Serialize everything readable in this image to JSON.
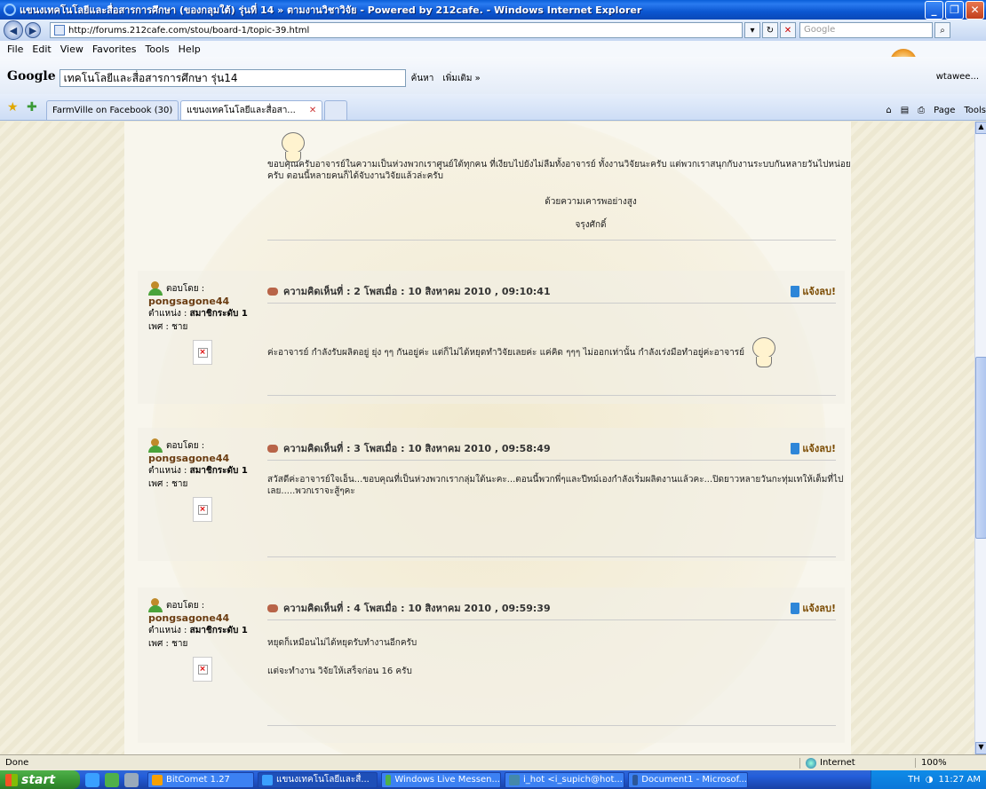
{
  "window": {
    "title": "แขนงเทคโนโลยีและสื่อสารการศึกษา (ของกลุมใต้) รุ่นที่ 14 » ตามงานวิชาวิจัย - Powered by 212cafe. - Windows Internet Explorer"
  },
  "address": {
    "url": "http://forums.212cafe.com/stou/board-1/topic-39.html",
    "search_placeholder": "Google"
  },
  "menu": [
    "File",
    "Edit",
    "View",
    "Favorites",
    "Tools",
    "Help"
  ],
  "google_toolbar": {
    "logo": "Google",
    "query": "เทคโนโลยีและสื่อสารการศึกษา รุ่น14",
    "search_label": "ค้นหา",
    "more_label": "เพิ่มเติม »",
    "user": "wtawee..."
  },
  "tabs": [
    {
      "label": "FarmVille on Facebook (30)"
    },
    {
      "label": "แขนงเทคโนโลยีและสื่อสา..."
    }
  ],
  "commands": [
    "Page",
    "Tools"
  ],
  "posts": [
    {
      "text": "ขอบคุณครับอาจารย์ในความเป็นห่วงพวกเราศูนย์ใต้ทุกคน ที่เงียบไปยังไม่ลืมทั้งอาจารย์ ทั้งงานวิจัยนะครับ แต่พวกเราสนุกกับงานระบบกันหลายวันไปหน่อยครับ ตอนนี้หลายคนก็ได้จับงานวิจัยแล้วล่ะครับ",
      "closing": "ด้วยความเคารพอย่างสูง",
      "signature": "จรุงศักดิ์"
    },
    {
      "author_prefix": "ตอบโดย :",
      "author": "pongsagone44",
      "rank_label": "ตำแหน่ง :",
      "rank": "สมาชิกระดับ 1",
      "gender": "เพศ : ชาย",
      "header": "ความคิดเห็นที่ : 2 โพสเมื่อ : 10 สิงหาคม 2010 , 09:10:41",
      "report": "แจ้งลบ!",
      "text": "ค่ะอาจารย์ กำลังรับผลิตอยู่ ยุ่ง ๆๆ กันอยู่ค่ะ แต่ก็ไม่ได้หยุดทำวิจัยเลยค่ะ แค่คิด ๆๆๆ ไม่ออกเท่านั้น กำลังเร่งมือทำอยู่ค่ะอาจารย์"
    },
    {
      "author_prefix": "ตอบโดย :",
      "author": "pongsagone44",
      "rank_label": "ตำแหน่ง :",
      "rank": "สมาชิกระดับ 1",
      "gender": "เพศ : ชาย",
      "header": "ความคิดเห็นที่ : 3 โพสเมื่อ : 10 สิงหาคม 2010 , 09:58:49",
      "report": "แจ้งลบ!",
      "text": "สวัสดีค่ะอาจารย์ใจเอ็น...ขอบคุณที่เป็นห่วงพวกเรากลุ่มใต้นะคะ...ตอนนี้พวกพี่ๆและปีทม์เองกำลังเริ่มผลิตงานแล้วคะ...ปิดยาวหลายวันกะทุ่มเทให้เต็มที่ไปเลย.....พวกเราจะสู้ๆคะ"
    },
    {
      "author_prefix": "ตอบโดย :",
      "author": "pongsagone44",
      "rank_label": "ตำแหน่ง :",
      "rank": "สมาชิกระดับ 1",
      "gender": "เพศ : ชาย",
      "header": "ความคิดเห็นที่ : 4 โพสเมื่อ : 10 สิงหาคม 2010 , 09:59:39",
      "report": "แจ้งลบ!",
      "text": "หยุดก็เหมือนไม่ได้หยุดรับทำงานอีกครับ",
      "text2": "แต่จะทำงาน วิจัยให้เสร็จก่อน 16 ครับ"
    }
  ],
  "status": {
    "text": "Done",
    "zone": "Internet",
    "zoom": "100%"
  },
  "taskbar": {
    "start": "start",
    "tasks": [
      "BitComet 1.27",
      "แขนงเทคโนโลยีและสื่...",
      "Windows Live Messen...",
      "i_hot <i_supich@hot...",
      "Document1 - Microsof..."
    ],
    "lang": "TH",
    "clock": "11:27 AM"
  }
}
